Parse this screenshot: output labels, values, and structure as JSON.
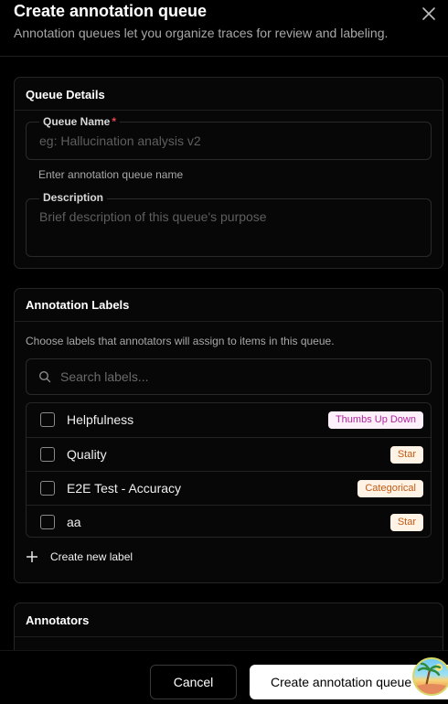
{
  "dialog": {
    "title": "Create annotation queue",
    "subtitle": "Annotation queues let you organize traces for review and labeling."
  },
  "queue_details": {
    "title": "Queue Details",
    "name_label": "Queue Name",
    "name_required_mark": "*",
    "name_placeholder": "eg: Hallucination analysis v2",
    "name_helper": "Enter annotation queue name",
    "description_label": "Description",
    "description_placeholder": "Brief description of this queue's purpose"
  },
  "annotation_labels": {
    "title": "Annotation Labels",
    "hint": "Choose labels that annotators will assign to items in this queue.",
    "search_placeholder": "Search labels...",
    "items": [
      {
        "label": "Helpfulness",
        "type": "Thumbs Up Down",
        "checked": false
      },
      {
        "label": "Quality",
        "type": "Star",
        "checked": false
      },
      {
        "label": "E2E Test - Accuracy",
        "type": "Categorical",
        "checked": false
      },
      {
        "label": "aa",
        "type": "Star",
        "checked": false
      }
    ],
    "create_label": "Create new label"
  },
  "annotators": {
    "title": "Annotators"
  },
  "footer": {
    "cancel_label": "Cancel",
    "create_label": "Create annotation queue"
  },
  "colors": {
    "background": "#000000",
    "badge_thumbs_text": "#b0249c",
    "badge_thumbs_bg": "#fdf0fb",
    "badge_star_text": "#c35a14",
    "badge_star_bg": "#fff3e6",
    "required": "#e5484d"
  },
  "icons": {
    "close": "close-icon",
    "search": "search-icon",
    "plus": "plus-icon",
    "avatar": "avatar"
  }
}
